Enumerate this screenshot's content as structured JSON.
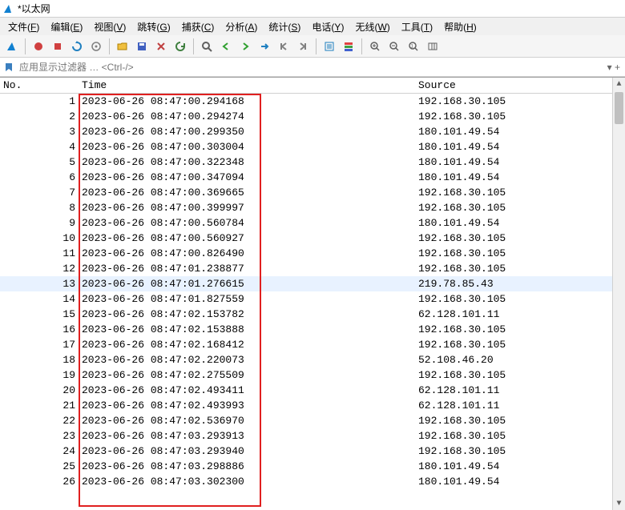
{
  "window": {
    "title": "*以太网"
  },
  "menu": [
    {
      "label": "文件(F)"
    },
    {
      "label": "编辑(E)"
    },
    {
      "label": "视图(V)"
    },
    {
      "label": "跳转(G)"
    },
    {
      "label": "捕获(C)"
    },
    {
      "label": "分析(A)"
    },
    {
      "label": "统计(S)"
    },
    {
      "label": "电话(Y)"
    },
    {
      "label": "无线(W)"
    },
    {
      "label": "工具(T)"
    },
    {
      "label": "帮助(H)"
    }
  ],
  "filter": {
    "placeholder": "应用显示过滤器 … <Ctrl-/>",
    "trailing": "▾  +"
  },
  "columns": {
    "no": "No.",
    "time": "Time",
    "source": "Source"
  },
  "selected_row": 13,
  "rows": [
    {
      "no": 1,
      "time": "2023-06-26 08:47:00.294168",
      "source": "192.168.30.105"
    },
    {
      "no": 2,
      "time": "2023-06-26 08:47:00.294274",
      "source": "192.168.30.105"
    },
    {
      "no": 3,
      "time": "2023-06-26 08:47:00.299350",
      "source": "180.101.49.54"
    },
    {
      "no": 4,
      "time": "2023-06-26 08:47:00.303004",
      "source": "180.101.49.54"
    },
    {
      "no": 5,
      "time": "2023-06-26 08:47:00.322348",
      "source": "180.101.49.54"
    },
    {
      "no": 6,
      "time": "2023-06-26 08:47:00.347094",
      "source": "180.101.49.54"
    },
    {
      "no": 7,
      "time": "2023-06-26 08:47:00.369665",
      "source": "192.168.30.105"
    },
    {
      "no": 8,
      "time": "2023-06-26 08:47:00.399997",
      "source": "192.168.30.105"
    },
    {
      "no": 9,
      "time": "2023-06-26 08:47:00.560784",
      "source": "180.101.49.54"
    },
    {
      "no": 10,
      "time": "2023-06-26 08:47:00.560927",
      "source": "192.168.30.105"
    },
    {
      "no": 11,
      "time": "2023-06-26 08:47:00.826490",
      "source": "192.168.30.105"
    },
    {
      "no": 12,
      "time": "2023-06-26 08:47:01.238877",
      "source": "192.168.30.105"
    },
    {
      "no": 13,
      "time": "2023-06-26 08:47:01.276615",
      "source": "219.78.85.43"
    },
    {
      "no": 14,
      "time": "2023-06-26 08:47:01.827559",
      "source": "192.168.30.105"
    },
    {
      "no": 15,
      "time": "2023-06-26 08:47:02.153782",
      "source": "62.128.101.11"
    },
    {
      "no": 16,
      "time": "2023-06-26 08:47:02.153888",
      "source": "192.168.30.105"
    },
    {
      "no": 17,
      "time": "2023-06-26 08:47:02.168412",
      "source": "192.168.30.105"
    },
    {
      "no": 18,
      "time": "2023-06-26 08:47:02.220073",
      "source": "52.108.46.20"
    },
    {
      "no": 19,
      "time": "2023-06-26 08:47:02.275509",
      "source": "192.168.30.105"
    },
    {
      "no": 20,
      "time": "2023-06-26 08:47:02.493411",
      "source": "62.128.101.11"
    },
    {
      "no": 21,
      "time": "2023-06-26 08:47:02.493993",
      "source": "62.128.101.11"
    },
    {
      "no": 22,
      "time": "2023-06-26 08:47:02.536970",
      "source": "192.168.30.105"
    },
    {
      "no": 23,
      "time": "2023-06-26 08:47:03.293913",
      "source": "192.168.30.105"
    },
    {
      "no": 24,
      "time": "2023-06-26 08:47:03.293940",
      "source": "192.168.30.105"
    },
    {
      "no": 25,
      "time": "2023-06-26 08:47:03.298886",
      "source": "180.101.49.54"
    },
    {
      "no": 26,
      "time": "2023-06-26 08:47:03.302300",
      "source": "180.101.49.54"
    }
  ],
  "toolbar_icons": [
    "shark-fin-icon",
    "folder-open-icon",
    "save-icon",
    "close-file-icon",
    "reload-icon",
    "find-icon",
    "prev-icon",
    "next-icon",
    "goto-icon",
    "first-icon",
    "last-icon",
    "auto-scroll-icon",
    "colorize-icon",
    "zoom-in-icon",
    "zoom-out-icon",
    "zoom-reset-icon",
    "resize-columns-icon"
  ]
}
